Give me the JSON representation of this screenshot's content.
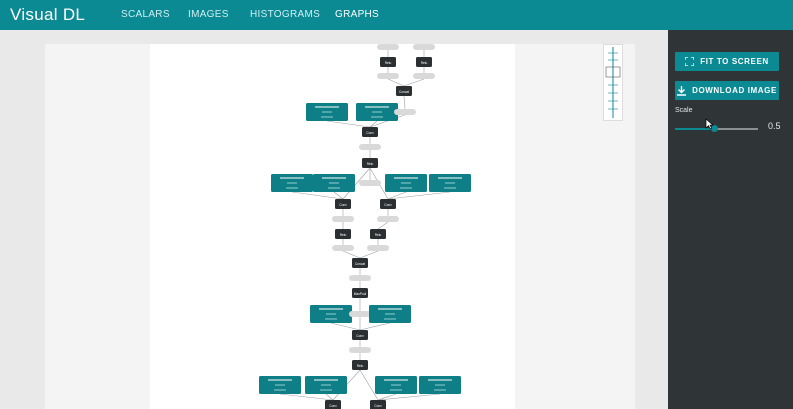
{
  "app": {
    "title": "Visual DL"
  },
  "nav": [
    {
      "label": "SCALARS",
      "active": false
    },
    {
      "label": "IMAGES",
      "active": false
    },
    {
      "label": "HISTOGRAMS",
      "active": false
    },
    {
      "label": "GRAPHS",
      "active": true
    }
  ],
  "panel": {
    "fit_label": "FIT TO SCREEN",
    "download_label": "DOWNLOAD IMAGE",
    "scale_label": "Scale",
    "scale_value": "0.5",
    "scale_fraction": 0.5
  },
  "icons": {
    "fit": "fullscreen-icon",
    "download": "download-icon"
  },
  "colors": {
    "topbar": "#0b8a94",
    "accent": "#0b8a94",
    "panel": "#2f3537",
    "op_node": "#2b2f31",
    "param_node": "#0e7f86",
    "data_node": "#d9d9d9"
  },
  "graph": {
    "op_nodes": [
      "Relu",
      "Relu",
      "Concat",
      "Conv",
      "Relu",
      "Conv",
      "Conv",
      "Relu",
      "Relu",
      "Concat",
      "MaxPool",
      "Conv",
      "Relu",
      "Conv",
      "Conv"
    ],
    "param_nodes": 16,
    "data_nodes": 18
  }
}
